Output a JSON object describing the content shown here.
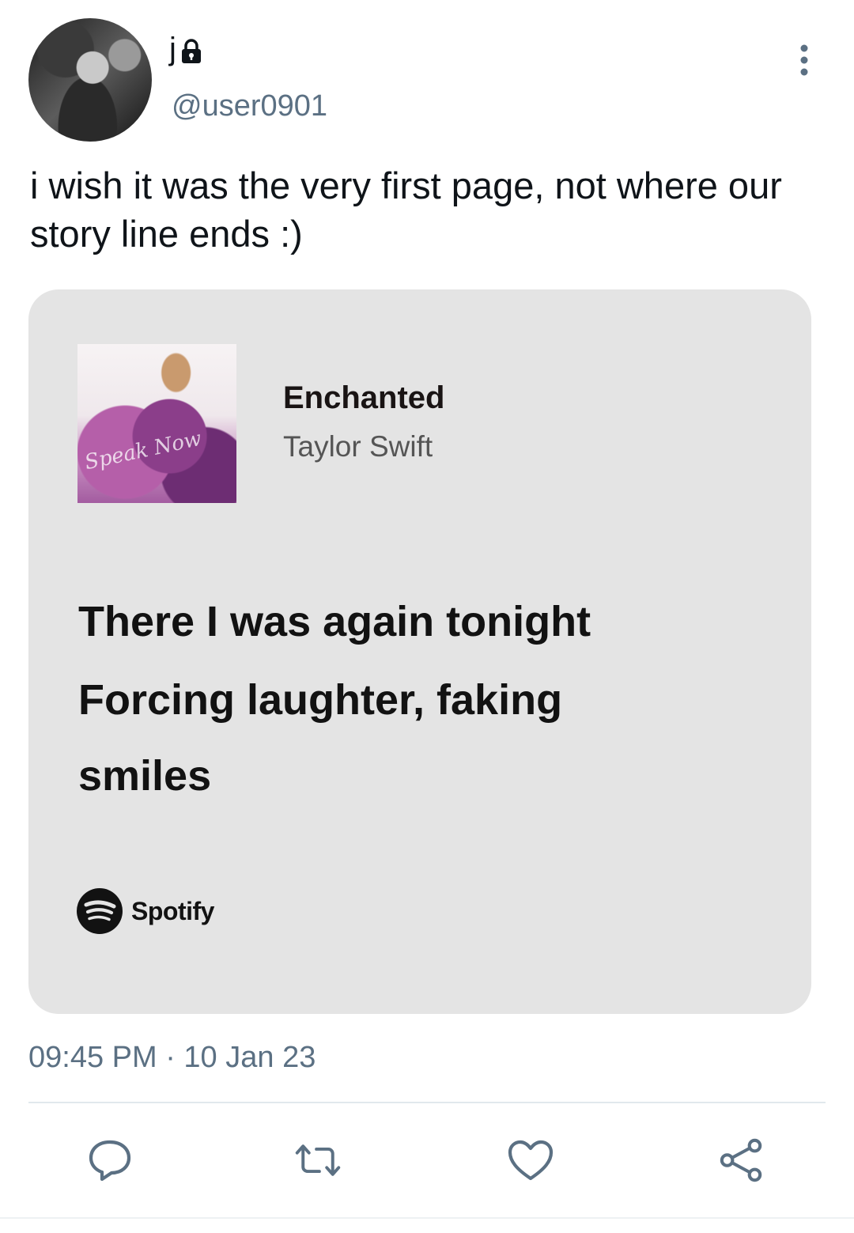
{
  "tweet": {
    "author": {
      "display_name": "j",
      "handle": "@user0901",
      "avatar_icon": "avatar-photo",
      "protected_icon": "lock-icon"
    },
    "text": "i wish it was the very first page, not where our story line ends :)",
    "timestamp": "09:45 PM · 10 Jan 23"
  },
  "card": {
    "song_title": "Enchanted",
    "artist": "Taylor Swift",
    "album_art_lettering": "Speak Now",
    "lyrics": [
      "There I was again tonight",
      "Forcing laughter, faking",
      "smiles"
    ],
    "brand": "Spotify",
    "background_color": "#e4e4e4"
  },
  "actions": [
    {
      "name": "reply",
      "icon": "reply-icon"
    },
    {
      "name": "retweet",
      "icon": "retweet-icon"
    },
    {
      "name": "like",
      "icon": "heart-icon"
    },
    {
      "name": "share",
      "icon": "share-icon"
    }
  ],
  "colors": {
    "text_primary": "#0f1419",
    "text_secondary": "#5b7083",
    "icon": "#5b7083"
  }
}
